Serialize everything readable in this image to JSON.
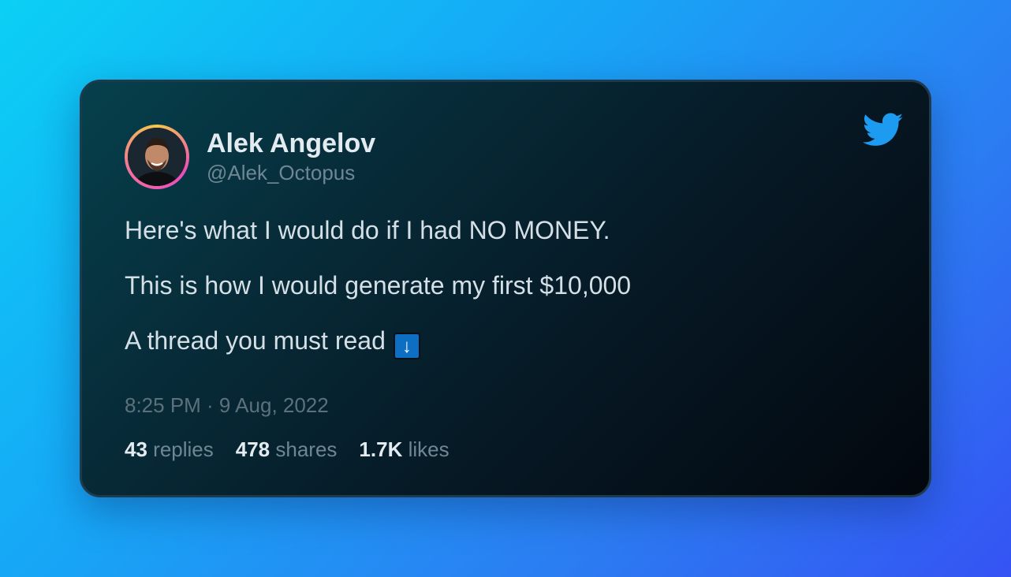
{
  "tweet": {
    "author": {
      "name": "Alek Angelov",
      "handle": "@Alek_Octopus",
      "avatar_icon": "profile-photo"
    },
    "lines": [
      "Here's what I would do if I had NO MONEY.",
      "This is how I would generate my first $10,000",
      "A thread you must read"
    ],
    "emoji": "↓",
    "timestamp": "8:25 PM · 9 Aug, 2022",
    "stats": {
      "replies": {
        "count": "43",
        "label": "replies"
      },
      "shares": {
        "count": "478",
        "label": "shares"
      },
      "likes": {
        "count": "1.7K",
        "label": "likes"
      }
    },
    "brand_icon": "twitter-bird-icon"
  },
  "colors": {
    "twitter_blue": "#1d9bf0",
    "emoji_blue": "#0d6fc4"
  }
}
